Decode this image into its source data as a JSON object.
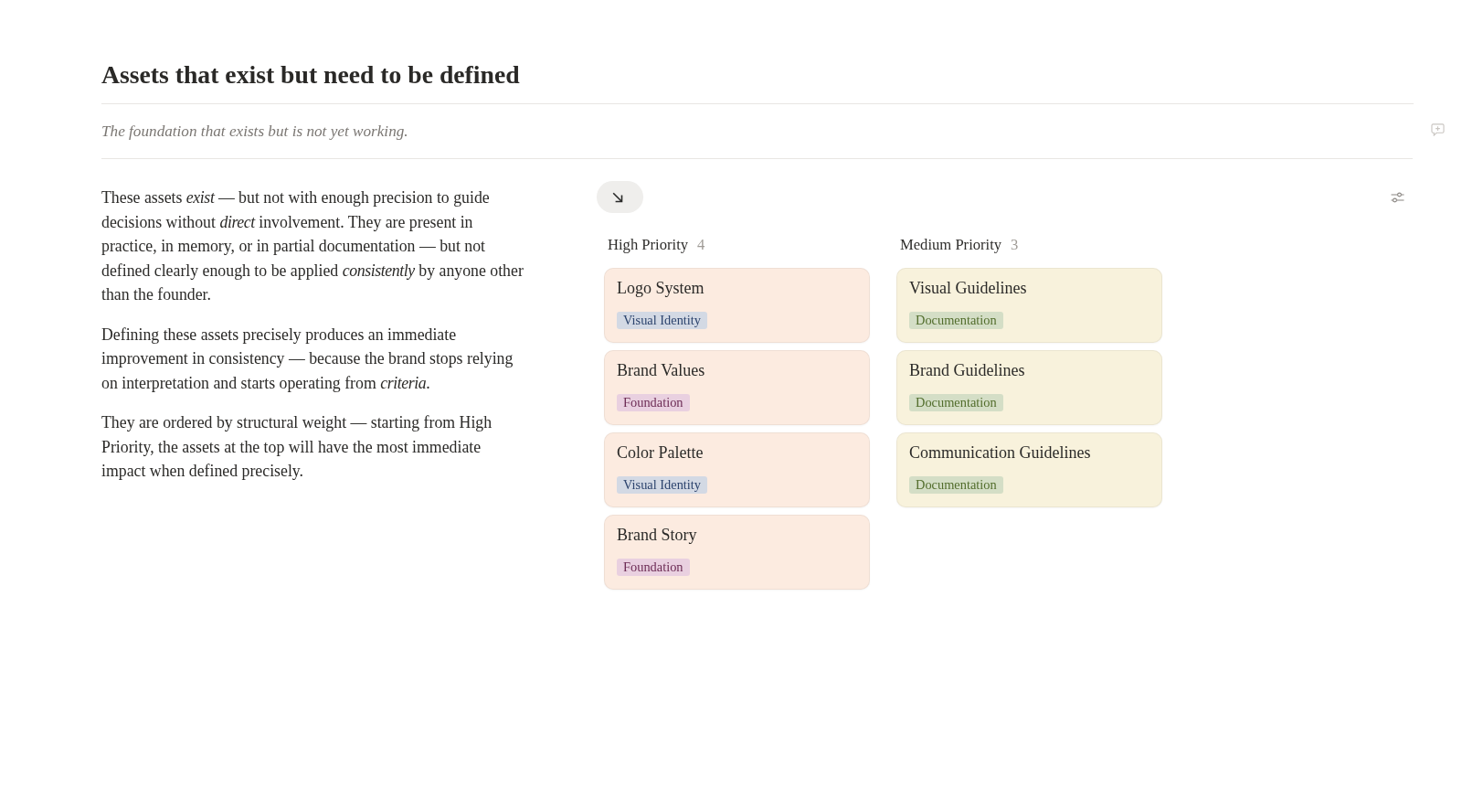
{
  "page": {
    "title": "Assets that exist but need to be defined",
    "subtitle": "The foundation that exists but is not yet working."
  },
  "intro": [
    "These assets *exist* — but not with enough precision to guide decisions without *direct* involvement. They are present in practice, in memory, or in partial documentation — but not defined clearly enough to be applied *consistently* by anyone other than the founder.",
    "Defining these assets precisely produces an immediate improvement in consistency — because the brand stops relying on interpretation and starts operating from *criteria*.",
    "They are ordered by structural weight — starting from High Priority, the assets at the top will have the most immediate impact when defined precisely."
  ],
  "board": {
    "columns": [
      {
        "name": "High Priority",
        "count": "4",
        "color": "#fcebe0",
        "cards": [
          {
            "title": "Logo System",
            "tag": {
              "label": "Visual Identity",
              "color": "#d3d9e4"
            }
          },
          {
            "title": "Brand Values",
            "tag": {
              "label": "Foundation",
              "color": "#e9d0e0"
            }
          },
          {
            "title": "Color Palette",
            "tag": {
              "label": "Visual Identity",
              "color": "#d3d9e4"
            }
          },
          {
            "title": "Brand Story",
            "tag": {
              "label": "Foundation",
              "color": "#e9d0e0"
            }
          }
        ]
      },
      {
        "name": "Medium Priority",
        "count": "3",
        "color": "#f8f2dc",
        "cards": [
          {
            "title": "Visual Guidelines",
            "tag": {
              "label": "Documentation",
              "color": "#d4dec6"
            }
          },
          {
            "title": "Brand Guidelines",
            "tag": {
              "label": "Documentation",
              "color": "#d4dec6"
            }
          },
          {
            "title": "Communication Guidelines",
            "tag": {
              "label": "Documentation",
              "color": "#d4dec6"
            }
          }
        ]
      }
    ]
  }
}
